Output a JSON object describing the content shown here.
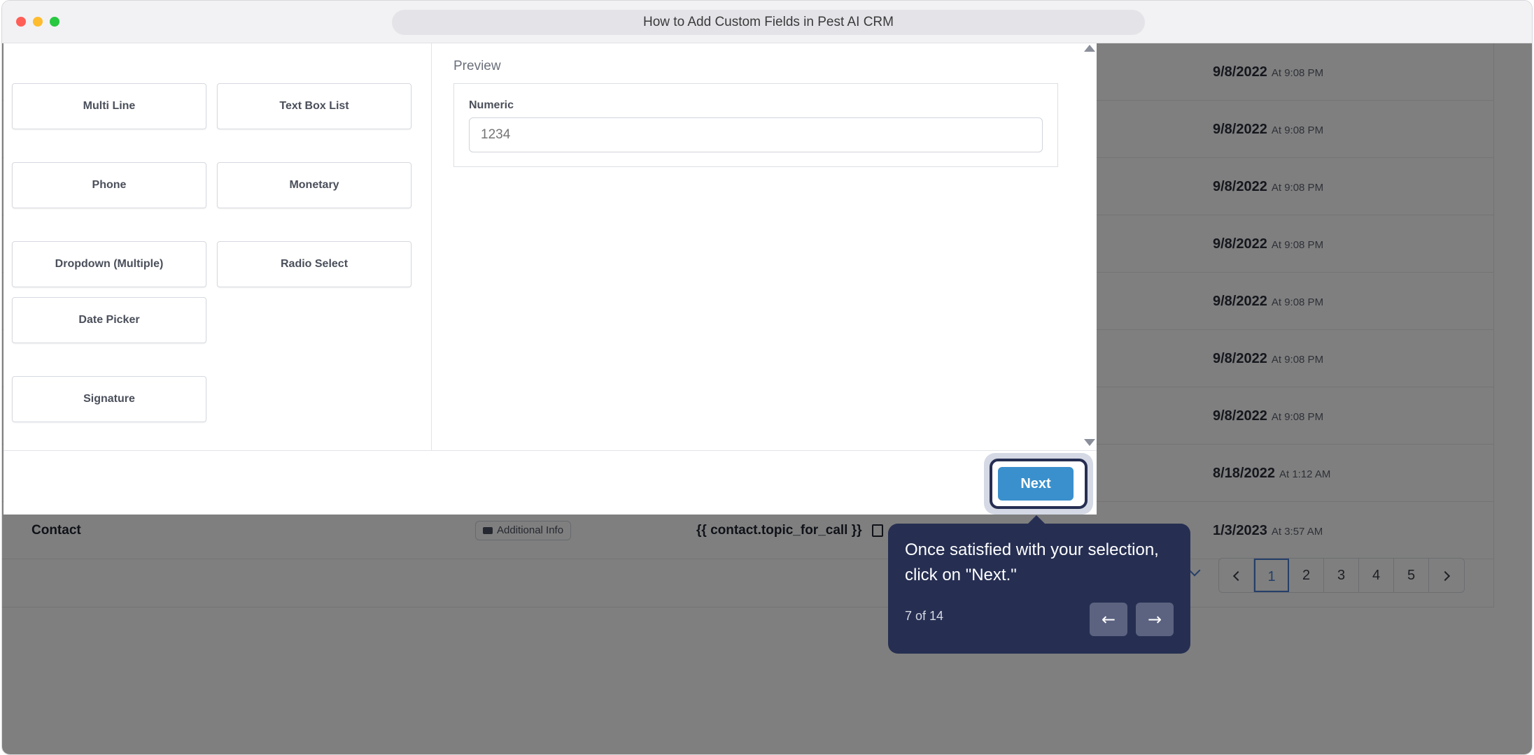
{
  "window": {
    "title": "How to Add Custom Fields in Pest AI CRM"
  },
  "background_list": {
    "rows": [
      {
        "date": "9/8/2022",
        "time": "At 9:08 PM"
      },
      {
        "date": "9/8/2022",
        "time": "At 9:08 PM"
      },
      {
        "date": "9/8/2022",
        "time": "At 9:08 PM"
      },
      {
        "date": "9/8/2022",
        "time": "At 9:08 PM"
      },
      {
        "date": "9/8/2022",
        "time": "At 9:08 PM"
      },
      {
        "date": "9/8/2022",
        "time": "At 9:08 PM"
      },
      {
        "date": "9/8/2022",
        "time": "At 9:08 PM"
      },
      {
        "date": "8/18/2022",
        "time": "At 1:12 AM"
      },
      {
        "date": "1/3/2023",
        "time": "At 3:57 AM"
      }
    ],
    "last_row": {
      "name": "Contact",
      "tag": "Additional Info",
      "merge_field": "{{ contact.topic_for_call }}"
    },
    "pagination": {
      "pages": [
        "1",
        "2",
        "3",
        "4",
        "5"
      ],
      "active_page": "1"
    }
  },
  "modal": {
    "field_types": [
      "Multi Line",
      "Text Box List",
      "Phone",
      "Monetary",
      "Dropdown (Multiple)",
      "Radio Select",
      "Date Picker",
      "Signature"
    ],
    "preview": {
      "title": "Preview",
      "field_label": "Numeric",
      "field_placeholder": "1234"
    },
    "next_label": "Next"
  },
  "tooltip": {
    "text": "Once satisfied with your selection, click on \"Next.\"",
    "step": "7 of 14",
    "prev_icon": "arrow-left-icon",
    "next_icon": "arrow-right-icon"
  }
}
